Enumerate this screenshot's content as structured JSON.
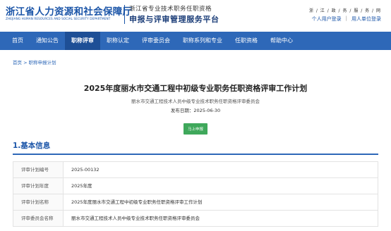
{
  "header": {
    "org_name": "浙江省人力资源和社会保障厅",
    "org_name_en": "ZHEJIANG HUMAN RESOURCES AND SOCIAL SECURITY DEPARTMENT",
    "system_line1": "浙江省专业技术职务任职资格",
    "system_line2": "申报与评审管理服务平台",
    "portal_link": "浙 / 江 / 政 / 务 / 服 / 务 / 网",
    "personal_login": "个人用户登录",
    "separator": "|",
    "org_login": "用人单位登录"
  },
  "nav": {
    "items": [
      {
        "label": "首页"
      },
      {
        "label": "通知公告"
      },
      {
        "label": "职称评审"
      },
      {
        "label": "职称认定"
      },
      {
        "label": "评审委员会"
      },
      {
        "label": "职称系列和专业"
      },
      {
        "label": "任职资格"
      },
      {
        "label": "帮助中心"
      }
    ],
    "active_index": 2
  },
  "breadcrumb": "首页 > 职称申报计划",
  "plan": {
    "title": "2025年度丽水市交通工程中初级专业职务任职资格评审工作计划",
    "publisher": "丽水市交通工程技术人员中级专业技术职务任职资格评审委员会",
    "date_line": "发布日期：2025-06-30",
    "apply_button": "马上申报"
  },
  "section": {
    "title": "1.基本信息"
  },
  "info_rows": [
    {
      "label": "评审计划编号",
      "value": "2025-00132"
    },
    {
      "label": "评审计划年度",
      "value": "2025年度"
    },
    {
      "label": "评审计划名称",
      "value": "2025年度丽水市交通工程中初级专业职务任职资格评审工作计划"
    },
    {
      "label": "评审委员会名称",
      "value": "丽水市交通工程技术人员中级专业技术职务任职资格评审委员会"
    }
  ],
  "colors": {
    "brand_blue": "#1b55a8",
    "nav_bg": "#2e68b8",
    "nav_active": "#1e4f96",
    "apply_green": "#3fa85b"
  }
}
